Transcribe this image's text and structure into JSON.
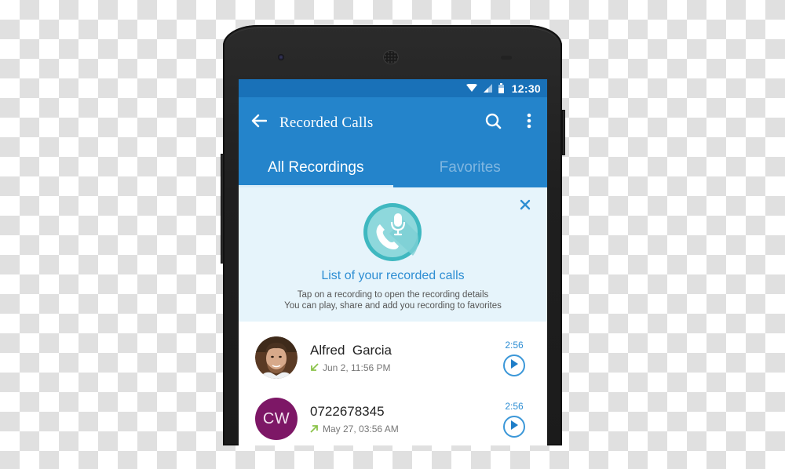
{
  "status_bar": {
    "time": "12:30",
    "icons": [
      "wifi-icon",
      "signal-icon",
      "battery-icon"
    ]
  },
  "app_bar": {
    "title": "Recorded Calls",
    "back_icon": "arrow-back-icon",
    "search_icon": "search-icon",
    "more_icon": "more-vertical-icon"
  },
  "tabs": [
    {
      "label": "All Recordings",
      "active": true
    },
    {
      "label": "Favorites",
      "active": false
    }
  ],
  "banner": {
    "icon": "phone-microphone-icon",
    "title": "List of your recorded calls",
    "line1": "Tap on a recording to open the recording details",
    "line2": "You can play, share and add you recording to favorites",
    "close_icon": "close-icon"
  },
  "recordings": [
    {
      "name": "Alfred  Garcia",
      "avatar_type": "photo",
      "direction": "incoming",
      "date": "Jun 2, 11:56 PM",
      "duration": "2:56"
    },
    {
      "name": "0722678345",
      "avatar_type": "initials",
      "initials": "CW",
      "direction": "outgoing",
      "date": "May 27, 03:56 AM",
      "duration": "2:56"
    }
  ],
  "colors": {
    "status_bar": "#1971b8",
    "app_bar": "#2484cb",
    "tab_inactive": "#7fb6e0",
    "banner_bg": "#e6f4fb",
    "accent": "#2e8ed3",
    "initials_avatar": "#7d1766",
    "direction_arrow": "#8bc34a"
  }
}
